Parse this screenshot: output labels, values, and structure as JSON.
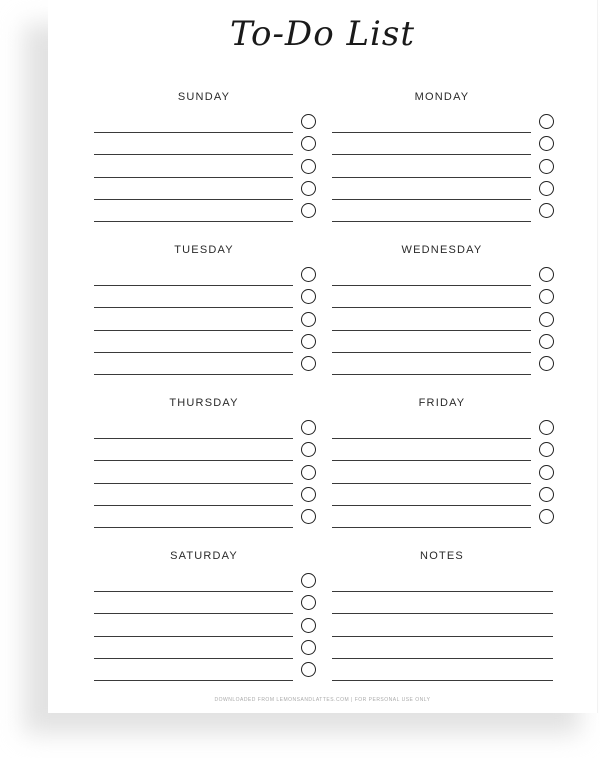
{
  "title": "To-Do List",
  "sections": [
    {
      "id": "sunday",
      "label": "SUNDAY",
      "rows": 5,
      "has_checkboxes": true
    },
    {
      "id": "monday",
      "label": "MONDAY",
      "rows": 5,
      "has_checkboxes": true
    },
    {
      "id": "tuesday",
      "label": "TUESDAY",
      "rows": 5,
      "has_checkboxes": true
    },
    {
      "id": "wednesday",
      "label": "WEDNESDAY",
      "rows": 5,
      "has_checkboxes": true
    },
    {
      "id": "thursday",
      "label": "THURSDAY",
      "rows": 5,
      "has_checkboxes": true
    },
    {
      "id": "friday",
      "label": "FRIDAY",
      "rows": 5,
      "has_checkboxes": true
    },
    {
      "id": "saturday",
      "label": "SATURDAY",
      "rows": 5,
      "has_checkboxes": true
    },
    {
      "id": "notes",
      "label": "NOTES",
      "rows": 5,
      "has_checkboxes": false
    }
  ],
  "footer": "DOWNLOADED FROM LEMONSANDLATTES.COM | FOR PERSONAL USE ONLY",
  "colors": {
    "ink": "#222222",
    "line": "#3a3a3a",
    "footer_text": "#aaaaaa",
    "shadow": "#e2e2e2"
  }
}
